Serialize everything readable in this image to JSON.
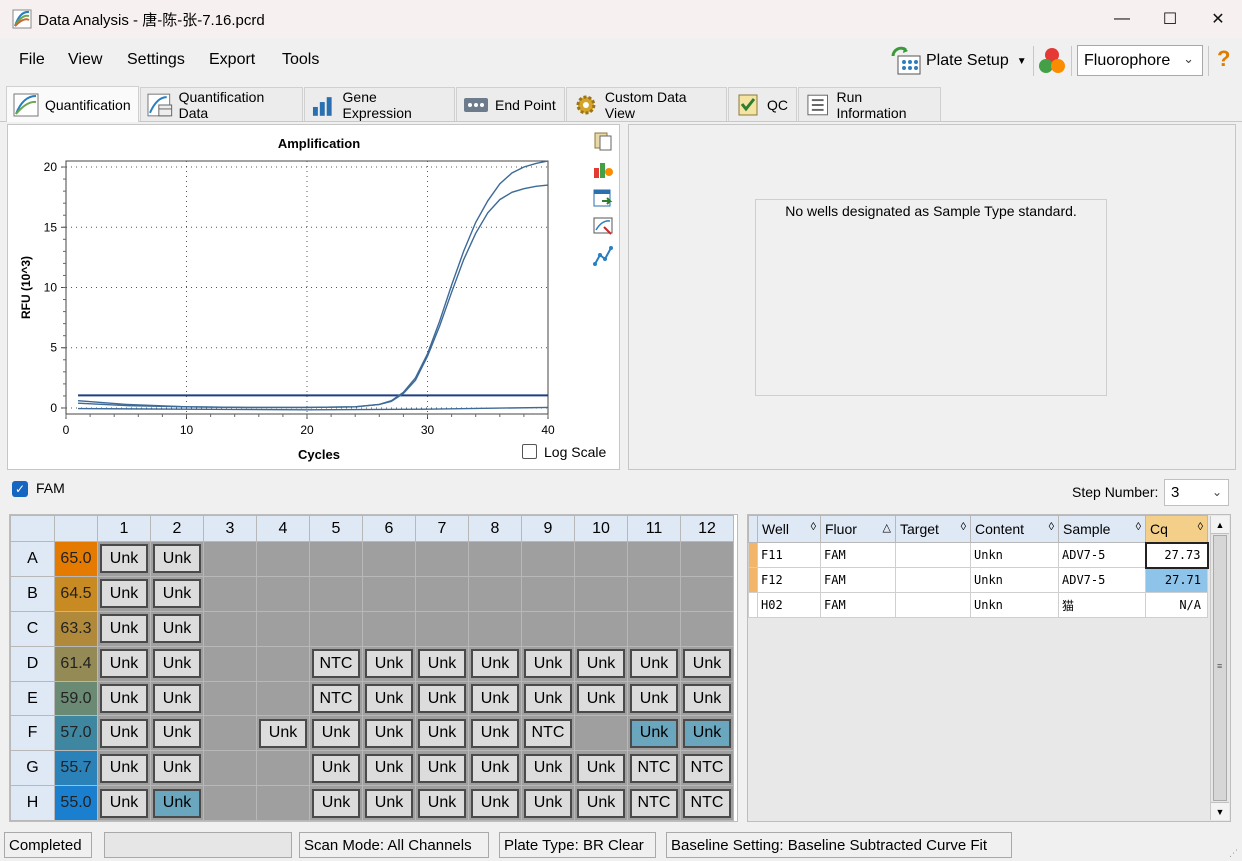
{
  "window": {
    "title": "Data Analysis - 唐-陈-张-7.16.pcrd"
  },
  "menu": {
    "file": "File",
    "view": "View",
    "settings": "Settings",
    "export": "Export",
    "tools": "Tools",
    "plate_setup": "Plate Setup",
    "fluorophore": "Fluorophore"
  },
  "tabs": [
    {
      "label": "Quantification",
      "icon": "amplification-icon"
    },
    {
      "label": "Quantification Data",
      "icon": "quant-data-icon"
    },
    {
      "label": "Gene Expression",
      "icon": "bar-chart-icon"
    },
    {
      "label": "End Point",
      "icon": "end-point-icon"
    },
    {
      "label": "Custom Data View",
      "icon": "gear-icon"
    },
    {
      "label": "QC",
      "icon": "qc-check-icon"
    },
    {
      "label": "Run Information",
      "icon": "run-info-icon"
    }
  ],
  "chart_data": {
    "type": "line",
    "title": "Amplification",
    "xlabel": "Cycles",
    "ylabel": "RFU (10^3)",
    "xlim": [
      0,
      40
    ],
    "ylim": [
      -0.5,
      20.5
    ],
    "xticks": [
      0,
      10,
      20,
      30,
      40
    ],
    "yticks": [
      0,
      5,
      10,
      15,
      20
    ],
    "grid": true,
    "threshold": 1.05,
    "series": [
      {
        "x": [
          1,
          5,
          10,
          15,
          20,
          24,
          26,
          27,
          28,
          29,
          30,
          31,
          32,
          33,
          34,
          35,
          36,
          37,
          38,
          39,
          40
        ],
        "y": [
          0.6,
          0.3,
          0.1,
          0.05,
          0.05,
          0.1,
          0.3,
          0.6,
          1.3,
          2.5,
          4.5,
          7.2,
          10.2,
          13.0,
          15.4,
          17.2,
          18.6,
          19.5,
          20.0,
          20.3,
          20.5
        ]
      },
      {
        "x": [
          1,
          5,
          10,
          15,
          20,
          24,
          26,
          27,
          28,
          29,
          30,
          31,
          32,
          33,
          34,
          35,
          36,
          37,
          38,
          39,
          40
        ],
        "y": [
          0.4,
          0.2,
          0.1,
          0.05,
          0.05,
          0.1,
          0.3,
          0.55,
          1.2,
          2.3,
          4.3,
          6.8,
          9.6,
          12.3,
          14.5,
          16.2,
          17.3,
          17.9,
          18.2,
          18.4,
          18.5
        ]
      },
      {
        "x": [
          1,
          10,
          20,
          30,
          40
        ],
        "y": [
          -0.05,
          -0.1,
          -0.15,
          -0.1,
          0.05
        ]
      }
    ]
  },
  "chart": {
    "log_scale_label": "Log Scale"
  },
  "right_panel": {
    "message": "No wells designated as Sample Type standard."
  },
  "fam": {
    "label": "FAM"
  },
  "step": {
    "label": "Step Number:",
    "value": "3"
  },
  "plate": {
    "columns": [
      "1",
      "2",
      "3",
      "4",
      "5",
      "6",
      "7",
      "8",
      "9",
      "10",
      "11",
      "12"
    ],
    "rows": [
      {
        "row": "A",
        "temp": "65.0",
        "temp_color": "#e47b00",
        "cells": [
          "Unk",
          "Unk",
          "",
          "",
          "",
          "",
          "",
          "",
          "",
          "",
          "",
          ""
        ]
      },
      {
        "row": "B",
        "temp": "64.5",
        "temp_color": "#c88a22",
        "cells": [
          "Unk",
          "Unk",
          "",
          "",
          "",
          "",
          "",
          "",
          "",
          "",
          "",
          ""
        ]
      },
      {
        "row": "C",
        "temp": "63.3",
        "temp_color": "#b08a3a",
        "cells": [
          "Unk",
          "Unk",
          "",
          "",
          "",
          "",
          "",
          "",
          "",
          "",
          "",
          ""
        ]
      },
      {
        "row": "D",
        "temp": "61.4",
        "temp_color": "#938a55",
        "cells": [
          "Unk",
          "Unk",
          "",
          "",
          "NTC",
          "Unk",
          "Unk",
          "Unk",
          "Unk",
          "Unk",
          "Unk",
          "Unk"
        ]
      },
      {
        "row": "E",
        "temp": "59.0",
        "temp_color": "#6a8a74",
        "cells": [
          "Unk",
          "Unk",
          "",
          "",
          "NTC",
          "Unk",
          "Unk",
          "Unk",
          "Unk",
          "Unk",
          "Unk",
          "Unk"
        ]
      },
      {
        "row": "F",
        "temp": "57.0",
        "temp_color": "#3f86a0",
        "cells": [
          "Unk",
          "Unk",
          "",
          "Unk",
          "Unk",
          "Unk",
          "Unk",
          "Unk",
          "NTC",
          "",
          "Unk",
          "Unk"
        ]
      },
      {
        "row": "G",
        "temp": "55.7",
        "temp_color": "#2b82b8",
        "cells": [
          "Unk",
          "Unk",
          "",
          "",
          "Unk",
          "Unk",
          "Unk",
          "Unk",
          "Unk",
          "Unk",
          "NTC",
          "NTC"
        ]
      },
      {
        "row": "H",
        "temp": "55.0",
        "temp_color": "#1b7fd0",
        "cells": [
          "Unk",
          "Unk",
          "",
          "",
          "Unk",
          "Unk",
          "Unk",
          "Unk",
          "Unk",
          "Unk",
          "NTC",
          "NTC"
        ]
      }
    ],
    "selected": [
      "F11",
      "F12",
      "H2"
    ]
  },
  "data_table": {
    "headers": [
      "Well",
      "Fluor",
      "Target",
      "Content",
      "Sample",
      "Cq"
    ],
    "rows": [
      {
        "well": "F11",
        "fluor": "FAM",
        "target": "",
        "content": "Unkn",
        "sample": "ADV7-5",
        "cq": "27.73"
      },
      {
        "well": "F12",
        "fluor": "FAM",
        "target": "",
        "content": "Unkn",
        "sample": "ADV7-5",
        "cq": "27.71"
      },
      {
        "well": "H02",
        "fluor": "FAM",
        "target": "",
        "content": "Unkn",
        "sample": "猫",
        "cq": "N/A"
      }
    ]
  },
  "status": {
    "state": "Completed",
    "scan_mode": "Scan Mode: All Channels",
    "plate_type": "Plate Type: BR Clear",
    "baseline": "Baseline Setting: Baseline Subtracted Curve Fit"
  }
}
